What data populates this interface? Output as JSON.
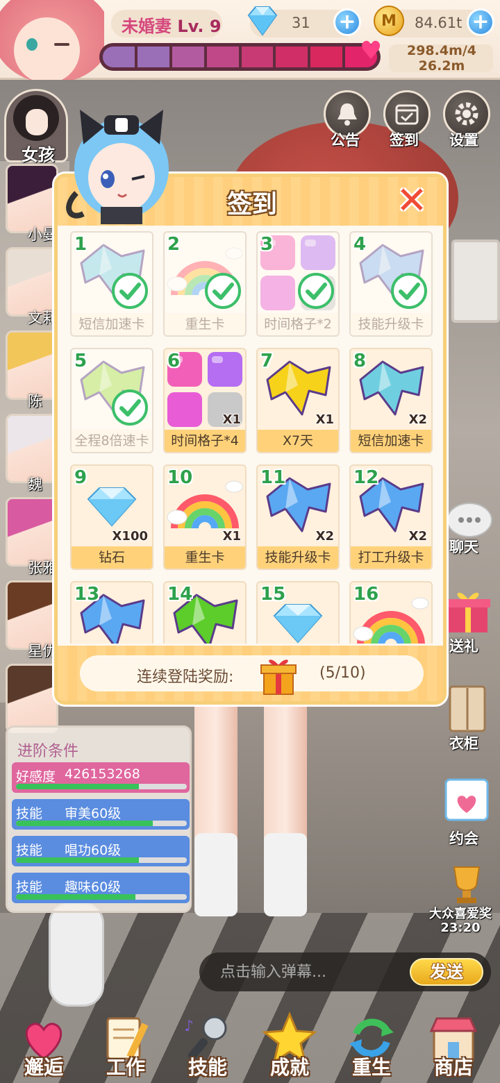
{
  "topbar": {
    "rank_title": "未婚妻",
    "rank_level": "Lv. 9",
    "gems": "31",
    "coins": "84.61t",
    "coin_glyph": "M",
    "love_text": "298.4m/4 26.2m",
    "progress_colors": [
      "#9b6fb8",
      "#9b6fb8",
      "#b25ba0",
      "#c04888",
      "#c83a74",
      "#cf2f66",
      "#d9285e",
      "#e2246a"
    ]
  },
  "sidebar": {
    "girls_label": "女孩",
    "characters": [
      {
        "label": "小曼",
        "hair": "#3b1e3a"
      },
      {
        "label": "文莉",
        "hair": "#e8ded4"
      },
      {
        "label": "陈小…",
        "hair": "#f3c65a"
      },
      {
        "label": "魏小…",
        "hair": "#ece6ea"
      },
      {
        "label": "张雅",
        "hair": "#d85aa0"
      },
      {
        "label": "星优",
        "hair": "#6a3c24"
      },
      {
        "label": "",
        "hair": "#5a3a2a"
      }
    ]
  },
  "top_icons": {
    "notice": "公告",
    "checkin": "签到",
    "settings": "设置"
  },
  "side_icons": {
    "chat": "聊天",
    "gift": "送礼",
    "wardrobe": "衣柜",
    "date": "约会",
    "award": "大众喜爱奖",
    "award_time": "23:20"
  },
  "dialog": {
    "title": "签到",
    "close_glyph": "✕",
    "login_label": "连续登陆奖励:",
    "login_count": "(5/10)",
    "cells": [
      {
        "num": "1",
        "label": "短信加速卡",
        "qty": "",
        "claimed": true,
        "kind": "card",
        "color": "#7fd3e8"
      },
      {
        "num": "2",
        "label": "重生卡",
        "qty": "",
        "claimed": true,
        "kind": "rainbow",
        "color": ""
      },
      {
        "num": "3",
        "label": "时间格子*2",
        "qty": "",
        "claimed": true,
        "kind": "cubes",
        "color": ""
      },
      {
        "num": "4",
        "label": "技能升级卡",
        "qty": "",
        "claimed": true,
        "kind": "card",
        "color": "#8ab8f0"
      },
      {
        "num": "5",
        "label": "全程8倍速卡",
        "qty": "",
        "claimed": true,
        "kind": "card",
        "color": "#a6e04a"
      },
      {
        "num": "6",
        "label": "时间格子*4",
        "qty": "X1",
        "claimed": false,
        "kind": "cubes",
        "color": ""
      },
      {
        "num": "7",
        "label": "X7天",
        "qty": "X1",
        "claimed": false,
        "kind": "card",
        "color": "#f6d21a"
      },
      {
        "num": "8",
        "label": "短信加速卡",
        "qty": "X2",
        "claimed": false,
        "kind": "card",
        "color": "#6fcfe0"
      },
      {
        "num": "9",
        "label": "钻石",
        "qty": "X100",
        "claimed": false,
        "kind": "gem",
        "color": ""
      },
      {
        "num": "10",
        "label": "重生卡",
        "qty": "X1",
        "claimed": false,
        "kind": "rainbow",
        "color": ""
      },
      {
        "num": "11",
        "label": "技能升级卡",
        "qty": "X2",
        "claimed": false,
        "kind": "card",
        "color": "#5aa8f2"
      },
      {
        "num": "12",
        "label": "打工升级卡",
        "qty": "X2",
        "claimed": false,
        "kind": "card",
        "color": "#5aa8f2"
      },
      {
        "num": "13",
        "label": "",
        "qty": "",
        "claimed": false,
        "kind": "card",
        "color": "#5aa8f2"
      },
      {
        "num": "14",
        "label": "",
        "qty": "",
        "claimed": false,
        "kind": "card",
        "color": "#5ccd2a"
      },
      {
        "num": "15",
        "label": "",
        "qty": "",
        "claimed": false,
        "kind": "gem",
        "color": ""
      },
      {
        "num": "16",
        "label": "",
        "qty": "",
        "claimed": false,
        "kind": "rainbow",
        "color": ""
      }
    ]
  },
  "advance": {
    "title": "进阶条件",
    "rows": [
      {
        "key": "好感度",
        "value": "426153268",
        "progress": 0.72,
        "color": "#e0669e"
      },
      {
        "key": "技能",
        "value": "审美60级",
        "progress": 0.8,
        "color": "#5a8ce0"
      },
      {
        "key": "技能",
        "value": "唱功60级",
        "progress": 0.72,
        "color": "#5a8ce0"
      },
      {
        "key": "技能",
        "value": "趣味60级",
        "progress": 0.7,
        "color": "#5a8ce0"
      }
    ]
  },
  "barrage": {
    "placeholder": "点击输入弹幕...",
    "send_label": "发送"
  },
  "nav": {
    "items": [
      {
        "label": "邂逅",
        "icon": "hearts-icon"
      },
      {
        "label": "工作",
        "icon": "notebook-icon"
      },
      {
        "label": "技能",
        "icon": "microphone-icon"
      },
      {
        "label": "成就",
        "icon": "star-icon"
      },
      {
        "label": "重生",
        "icon": "refresh-icon"
      },
      {
        "label": "商店",
        "icon": "shop-icon"
      }
    ]
  }
}
